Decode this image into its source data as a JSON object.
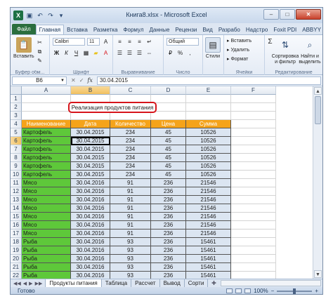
{
  "window": {
    "title": "Книга8.xlsx - Microsoft Excel",
    "app_icon": "X",
    "controls": {
      "minimize": "–",
      "maximize": "□",
      "close": "✕"
    }
  },
  "ribbon_tabs": [
    "Главная",
    "Вставка",
    "Разметка",
    "Формул",
    "Данные",
    "Рецензи",
    "Вид",
    "Разрабо",
    "Надстро",
    "Foxit PDI",
    "ABBYY Fin"
  ],
  "file_tab": "Файл",
  "ribbon": {
    "clipboard": {
      "label": "Буфер обм...",
      "paste": "Вставить"
    },
    "font": {
      "label": "Шрифт",
      "font_name": "Calibri",
      "font_size": "11"
    },
    "alignment": {
      "label": "Выравнивание"
    },
    "number": {
      "label": "Число",
      "format": "Общий"
    },
    "styles": {
      "label": "Стили",
      "styles_btn": "Стили"
    },
    "cells": {
      "label": "Ячейки",
      "insert": "Вставить",
      "delete": "Удалить",
      "format": "Формат"
    },
    "editing": {
      "label": "Редактирование",
      "sort": "Сортировка и фильтр",
      "find": "Найти и выделить",
      "sigma": "Σ"
    }
  },
  "formula_bar": {
    "name_box": "B6",
    "fx": "fx",
    "value": "30.04.2015"
  },
  "columns": [
    "A",
    "B",
    "C",
    "D",
    "E",
    "F"
  ],
  "rows": [
    "1",
    "2",
    "3",
    "4",
    "5",
    "6",
    "7",
    "8",
    "9",
    "10",
    "11",
    "12",
    "13",
    "14",
    "15",
    "16",
    "17",
    "18",
    "19",
    "20",
    "21",
    "22"
  ],
  "selected_cell": {
    "col": "B",
    "row": "6"
  },
  "title_cell": "Реализация продуктов питания",
  "table": {
    "headers": [
      "Наименование",
      "Дата",
      "Количество",
      "Цена",
      "Сумма"
    ],
    "rows": [
      [
        "Картофель",
        "30.04.2015",
        "234",
        "45",
        "10526"
      ],
      [
        "Картофель",
        "30.04.2015",
        "234",
        "45",
        "10526"
      ],
      [
        "Картофель",
        "30.04.2015",
        "234",
        "45",
        "10526"
      ],
      [
        "Картофель",
        "30.04.2015",
        "234",
        "45",
        "10526"
      ],
      [
        "Картофель",
        "30.04.2015",
        "234",
        "45",
        "10526"
      ],
      [
        "Картофель",
        "30.04.2015",
        "234",
        "45",
        "10526"
      ],
      [
        "Мясо",
        "30.04.2016",
        "91",
        "236",
        "21546"
      ],
      [
        "Мясо",
        "30.04.2016",
        "91",
        "236",
        "21546"
      ],
      [
        "Мясо",
        "30.04.2016",
        "91",
        "236",
        "21546"
      ],
      [
        "Мясо",
        "30.04.2016",
        "91",
        "236",
        "21546"
      ],
      [
        "Мясо",
        "30.04.2016",
        "91",
        "236",
        "21546"
      ],
      [
        "Мясо",
        "30.04.2016",
        "91",
        "236",
        "21546"
      ],
      [
        "Мясо",
        "30.04.2016",
        "91",
        "236",
        "21546"
      ],
      [
        "Рыба",
        "30.04.2016",
        "93",
        "236",
        "15461"
      ],
      [
        "Рыба",
        "30.04.2016",
        "93",
        "236",
        "15461"
      ],
      [
        "Рыба",
        "30.04.2016",
        "93",
        "236",
        "15461"
      ],
      [
        "Рыба",
        "30.04.2016",
        "93",
        "236",
        "15461"
      ],
      [
        "Рыба",
        "30.04.2016",
        "93",
        "236",
        "15461"
      ]
    ]
  },
  "sheets": [
    "Продукты питания",
    "Таблица",
    "Рассчет",
    "Вывод",
    "Сорти"
  ],
  "active_sheet": "Продукты питания",
  "status": {
    "ready": "Готово",
    "zoom": "100%"
  },
  "colors": {
    "header_bg": "#f5a31a",
    "name_bg": "#5ec83a",
    "value_bg": "#dbe5f1",
    "title_border": "#d6151b"
  }
}
